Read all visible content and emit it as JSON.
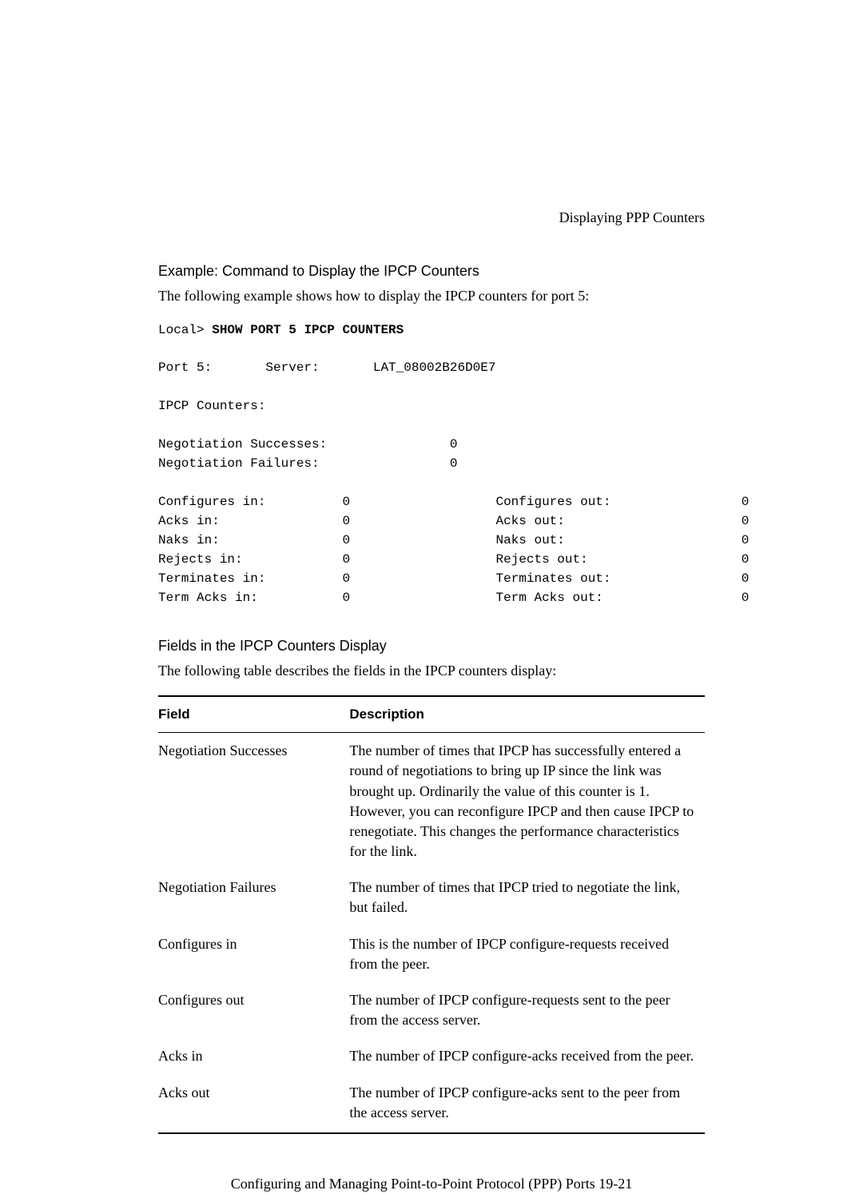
{
  "header": {
    "right_text": "Displaying PPP Counters"
  },
  "section1": {
    "title": "Example: Command to Display the IPCP Counters",
    "intro": "The following example shows how to display the IPCP counters for port 5:",
    "prompt": "Local>",
    "command": "SHOW PORT 5 IPCP COUNTERS"
  },
  "terminal": {
    "port_line": "Port 5:       Server:       LAT_08002B26D0E7",
    "counters_label": "IPCP Counters:",
    "neg_success_label": "Negotiation Successes:",
    "neg_success_val": "0",
    "neg_fail_label": "Negotiation Failures:",
    "neg_fail_val": "0",
    "rows": [
      {
        "l1": "Configures in:",
        "v1": "0",
        "l2": "Configures out:",
        "v2": "0"
      },
      {
        "l1": "Acks in:",
        "v1": "0",
        "l2": "Acks out:",
        "v2": "0"
      },
      {
        "l1": "Naks in:",
        "v1": "0",
        "l2": "Naks out:",
        "v2": "0"
      },
      {
        "l1": "Rejects in:",
        "v1": "0",
        "l2": "Rejects out:",
        "v2": "0"
      },
      {
        "l1": "Terminates in:",
        "v1": "0",
        "l2": "Terminates out:",
        "v2": "0"
      },
      {
        "l1": "Term Acks in:",
        "v1": "0",
        "l2": "Term Acks out:",
        "v2": "0"
      }
    ]
  },
  "section2": {
    "title": "Fields in the IPCP Counters Display",
    "intro": "The following table describes the fields in the IPCP counters display:"
  },
  "table": {
    "headers": {
      "field": "Field",
      "desc": "Description"
    },
    "rows": [
      {
        "field": "Negotiation Successes",
        "desc": "The number of times that IPCP has successfully entered a round of negotiations to bring up IP since the link was brought up. Ordinarily the value of this counter is 1. However, you can reconfigure IPCP and then cause IPCP to renegotiate. This changes the performance characteristics for the link."
      },
      {
        "field": "Negotiation Failures",
        "desc": "The number of times that IPCP tried to negotiate the link, but failed."
      },
      {
        "field": "Configures in",
        "desc": "This is the number of IPCP configure-requests received from the peer."
      },
      {
        "field": "Configures out",
        "desc": "The number of IPCP configure-requests sent to the peer from the access server."
      },
      {
        "field": "Acks in",
        "desc": "The number of IPCP configure-acks received from the peer."
      },
      {
        "field": "Acks out",
        "desc": "The number of IPCP configure-acks sent to the peer from the access server."
      }
    ]
  },
  "footer": {
    "text": "Configuring and Managing Point-to-Point Protocol (PPP) Ports 19-21"
  }
}
